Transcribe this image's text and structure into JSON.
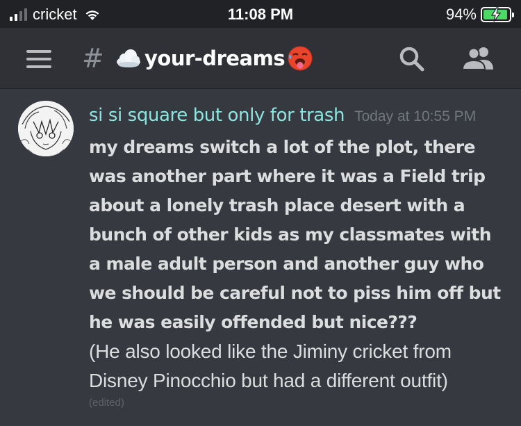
{
  "status_bar": {
    "carrier": "cricket",
    "time": "11:08 PM",
    "battery_percent": "94%",
    "battery_level": 0.94,
    "signal_bars": 2
  },
  "header": {
    "hash_symbol": "#",
    "channel_name": "your-dreams",
    "leading_emoji": "cloud-emoji",
    "trailing_emoji": "hot-face-emoji"
  },
  "message": {
    "username": "si si square but only for trash",
    "timestamp": "Today at 10:55 PM",
    "bold_lines": [
      "my dreams switch a lot of the plot, there",
      "was another part where it was a Field trip",
      "about a lonely trash place desert with a",
      "bunch of other kids  as my classmates with",
      "a male adult person and another guy who",
      "we should be careful not to piss him off but",
      "he was easily offended but nice???"
    ],
    "regular_lines": [
      "(He also looked like the Jiminy cricket from",
      "Disney Pinocchio but had a different outfit)"
    ],
    "edited_label": "(edited)"
  },
  "colors": {
    "background": "#36393f",
    "header_bg": "#2f3136",
    "username": "#8de4e0",
    "text": "#dcddde",
    "muted": "#72767d",
    "battery_green": "#4cd964"
  }
}
